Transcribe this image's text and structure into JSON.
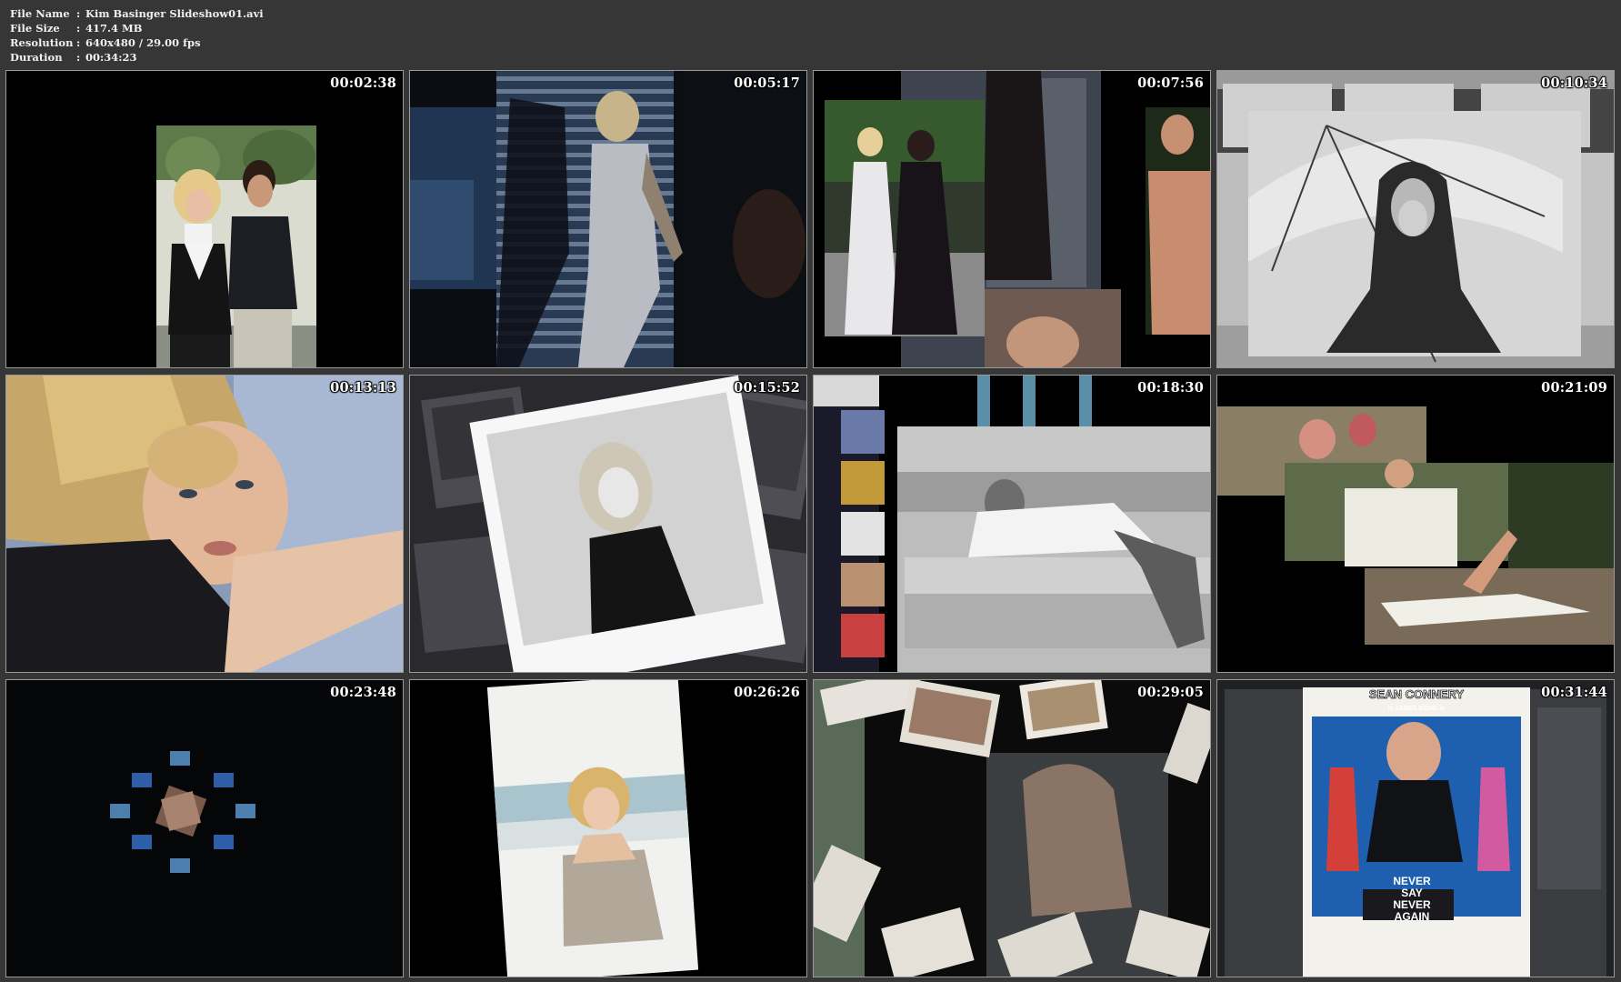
{
  "file_info": {
    "rows": [
      {
        "label": "File Name",
        "sep": ":",
        "value": "Kim Basinger Slideshow01.avi"
      },
      {
        "label": "File Size",
        "sep": ":",
        "value": "417.4 MB"
      },
      {
        "label": "Resolution",
        "sep": ":",
        "value": "640x480 / 29.00 fps"
      },
      {
        "label": "Duration",
        "sep": ":",
        "value": "00:34:23"
      }
    ]
  },
  "thumbnails": [
    {
      "timestamp": "00:02:38",
      "scene": "couple-portrait"
    },
    {
      "timestamp": "00:05:17",
      "scene": "blinds-shadow"
    },
    {
      "timestamp": "00:07:56",
      "scene": "collage-gowns"
    },
    {
      "timestamp": "00:10:34",
      "scene": "umbrella-bw"
    },
    {
      "timestamp": "00:13:13",
      "scene": "closeup-pillow"
    },
    {
      "timestamp": "00:15:52",
      "scene": "polaroid-bw"
    },
    {
      "timestamp": "00:18:30",
      "scene": "sofa-bw"
    },
    {
      "timestamp": "00:21:09",
      "scene": "collage-towel"
    },
    {
      "timestamp": "00:23:48",
      "scene": "blue-squares"
    },
    {
      "timestamp": "00:26:26",
      "scene": "beach-photo"
    },
    {
      "timestamp": "00:29:05",
      "scene": "scattered-photos"
    },
    {
      "timestamp": "00:31:44",
      "scene": "bond-poster"
    }
  ],
  "poster": {
    "headline": "SEAN CONNERY",
    "subline": "is JAMES BOND in",
    "title_line1": "NEVER",
    "title_line2": "SAY",
    "title_line3": "NEVER",
    "title_line4": "AGAIN"
  },
  "colors": {
    "background": "#363636",
    "thumb_border": "#9a9a9a",
    "text": "#ffffff"
  }
}
